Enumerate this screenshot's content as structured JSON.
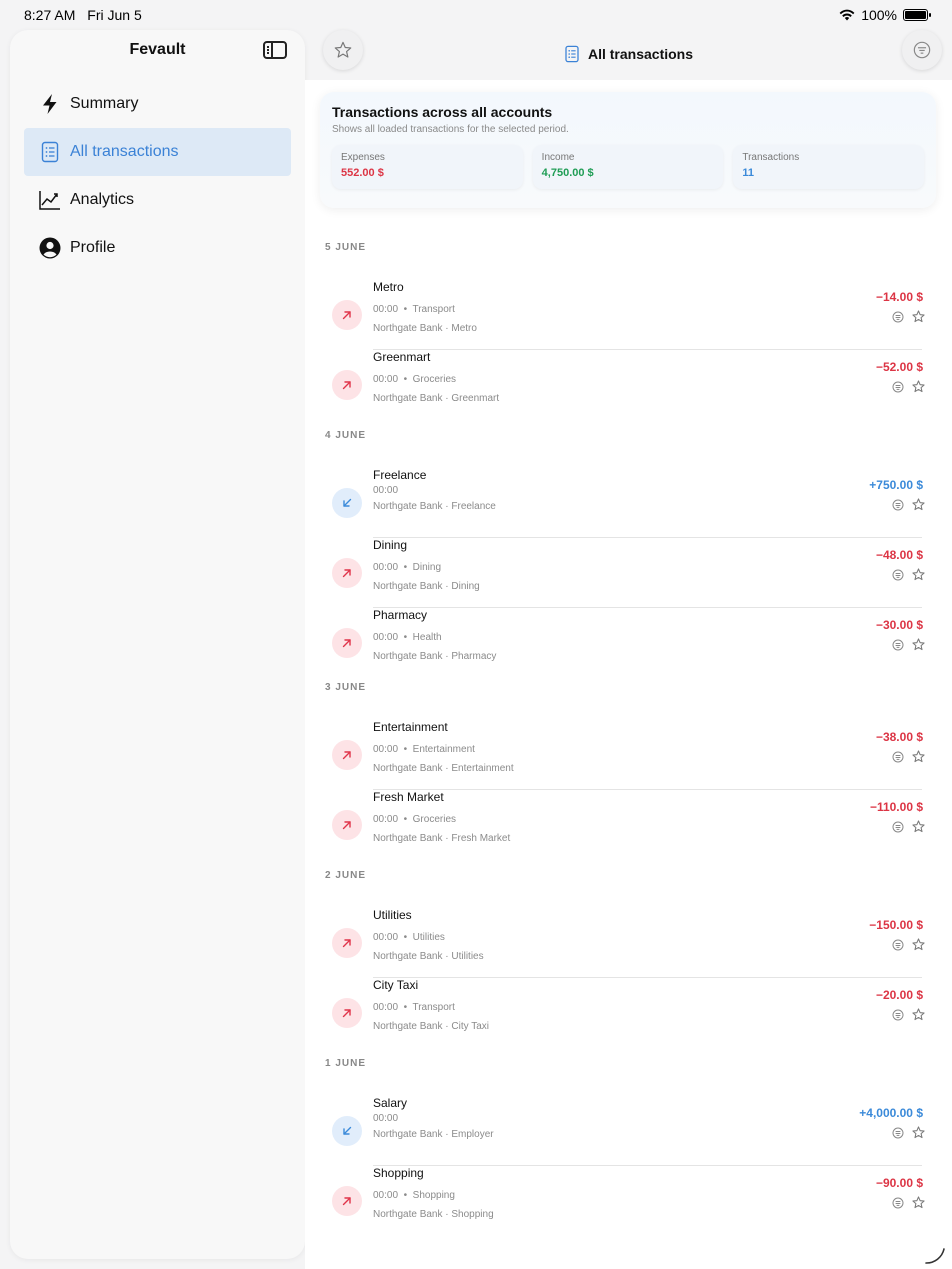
{
  "status": {
    "time": "8:27 AM",
    "date": "Fri Jun 5",
    "battery": "100%",
    "battery_level": 1.0
  },
  "sidebar": {
    "title": "Fevault",
    "items": [
      {
        "label": "Summary",
        "icon": "bolt-icon"
      },
      {
        "label": "All transactions",
        "icon": "list-document-icon",
        "active": true
      },
      {
        "label": "Analytics",
        "icon": "trend-chart-icon"
      },
      {
        "label": "Profile",
        "icon": "person-circle-icon"
      }
    ]
  },
  "topbar": {
    "title": "All transactions"
  },
  "summary": {
    "title": "Transactions across all accounts",
    "subtitle": "Shows all loaded transactions for the selected period.",
    "expenses_label": "Expenses",
    "expenses_value": "552.00 $",
    "income_label": "Income",
    "income_value": "4,750.00 $",
    "count_label": "Transactions",
    "count_value": "11"
  },
  "colors": {
    "expense": "#dc3545",
    "income_green": "#1f9d55",
    "income_blue": "#3b8ad9",
    "accent": "#3b82d6"
  },
  "groups": [
    {
      "date": "5 JUNE",
      "items": [
        {
          "name": "Metro",
          "time": "00:00",
          "category": "Transport",
          "account": "Northgate Bank · Metro",
          "amount": "−14.00 $",
          "direction": "out"
        },
        {
          "name": "Greenmart",
          "time": "00:00",
          "category": "Groceries",
          "account": "Northgate Bank · Greenmart",
          "amount": "−52.00 $",
          "direction": "out"
        }
      ]
    },
    {
      "date": "4 JUNE",
      "items": [
        {
          "name": "Freelance",
          "time": "00:00",
          "category": "",
          "account": "Northgate Bank · Freelance",
          "amount": "+750.00 $",
          "direction": "in"
        },
        {
          "name": "Dining",
          "time": "00:00",
          "category": "Dining",
          "account": "Northgate Bank · Dining",
          "amount": "−48.00 $",
          "direction": "out"
        },
        {
          "name": "Pharmacy",
          "time": "00:00",
          "category": "Health",
          "account": "Northgate Bank · Pharmacy",
          "amount": "−30.00 $",
          "direction": "out"
        }
      ]
    },
    {
      "date": "3 JUNE",
      "items": [
        {
          "name": "Entertainment",
          "time": "00:00",
          "category": "Entertainment",
          "account": "Northgate Bank · Entertainment",
          "amount": "−38.00 $",
          "direction": "out"
        },
        {
          "name": "Fresh Market",
          "time": "00:00",
          "category": "Groceries",
          "account": "Northgate Bank · Fresh Market",
          "amount": "−110.00 $",
          "direction": "out"
        }
      ]
    },
    {
      "date": "2 JUNE",
      "items": [
        {
          "name": "Utilities",
          "time": "00:00",
          "category": "Utilities",
          "account": "Northgate Bank · Utilities",
          "amount": "−150.00 $",
          "direction": "out"
        },
        {
          "name": "City Taxi",
          "time": "00:00",
          "category": "Transport",
          "account": "Northgate Bank · City Taxi",
          "amount": "−20.00 $",
          "direction": "out"
        }
      ]
    },
    {
      "date": "1 JUNE",
      "items": [
        {
          "name": "Salary",
          "time": "00:00",
          "category": "",
          "account": "Northgate Bank · Employer",
          "amount": "+4,000.00 $",
          "direction": "in"
        },
        {
          "name": "Shopping",
          "time": "00:00",
          "category": "Shopping",
          "account": "Northgate Bank · Shopping",
          "amount": "−90.00 $",
          "direction": "out"
        }
      ]
    }
  ]
}
